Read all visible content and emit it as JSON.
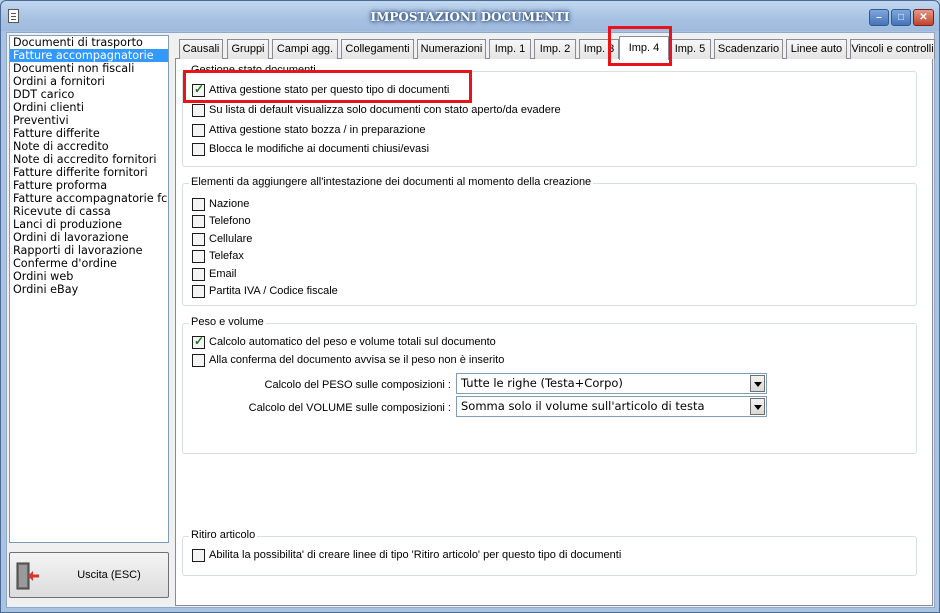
{
  "window": {
    "title": "IMPOSTAZIONI DOCUMENTI",
    "controls": {
      "minimize": "–",
      "maximize": "□",
      "close": "✕"
    }
  },
  "sidebar": {
    "items": [
      "Documenti di trasporto",
      "Fatture accompagnatorie",
      "Documenti non fiscali",
      "Ordini a fornitori",
      "DDT carico",
      "Ordini clienti",
      "Preventivi",
      "Fatture differite",
      "Note di accredito",
      "Note di accredito fornitori",
      "Fatture differite fornitori",
      "Fatture proforma",
      "Fatture accompagnatorie fc",
      "Ricevute di cassa",
      "Lanci di produzione",
      "Ordini di lavorazione",
      "Rapporti di lavorazione",
      "Conferme d'ordine",
      "Ordini web",
      "Ordini eBay"
    ],
    "selected": "Fatture accompagnatorie"
  },
  "exit_button": {
    "label": "Uscita (ESC)",
    "icon": "exit-door-icon"
  },
  "tabs": [
    "Causali",
    "Gruppi",
    "Campi agg.",
    "Collegamenti",
    "Numerazioni",
    "Imp. 1",
    "Imp. 2",
    "Imp. 3",
    "Imp. 4",
    "Imp. 5",
    "Scadenzario",
    "Linee auto",
    "Vincoli e controlli"
  ],
  "active_tab": "Imp. 4",
  "groups": {
    "stato": {
      "title": "Gestione stato documenti",
      "options": [
        {
          "label": "Attiva gestione stato per questo tipo di documenti",
          "checked": true
        },
        {
          "label": "Su lista di default visualizza solo documenti con stato aperto/da evadere",
          "checked": false
        },
        {
          "label": "Attiva gestione stato bozza / in preparazione",
          "checked": false
        },
        {
          "label": "Blocca le modifiche ai documenti chiusi/evasi",
          "checked": false
        }
      ]
    },
    "intestazione": {
      "title": "Elementi da aggiungere all'intestazione dei documenti al momento della creazione",
      "options": [
        {
          "label": "Nazione",
          "checked": false
        },
        {
          "label": "Telefono",
          "checked": false
        },
        {
          "label": "Cellulare",
          "checked": false
        },
        {
          "label": "Telefax",
          "checked": false
        },
        {
          "label": "Email",
          "checked": false
        },
        {
          "label": "Partita IVA / Codice fiscale",
          "checked": false
        }
      ]
    },
    "peso": {
      "title": "Peso e volume",
      "options": [
        {
          "label": "Calcolo automatico del peso e volume totali sul documento",
          "checked": true
        },
        {
          "label": "Alla conferma del documento avvisa se il peso non è inserito",
          "checked": false
        }
      ],
      "peso_label": "Calcolo del PESO sulle composizioni :",
      "peso_value": "Tutte le righe (Testa+Corpo)",
      "volume_label": "Calcolo del VOLUME sulle composizioni :",
      "volume_value": "Somma solo il volume sull'articolo di testa"
    },
    "ritiro": {
      "title": "Ritiro articolo",
      "options": [
        {
          "label": "Abilita la possibilita' di creare linee di tipo 'Ritiro articolo' per questo tipo di documenti",
          "checked": false
        }
      ]
    }
  },
  "colors": {
    "highlight": "#e8141b",
    "selection": "#3399ff",
    "titlebar": "#a6c1e2"
  }
}
